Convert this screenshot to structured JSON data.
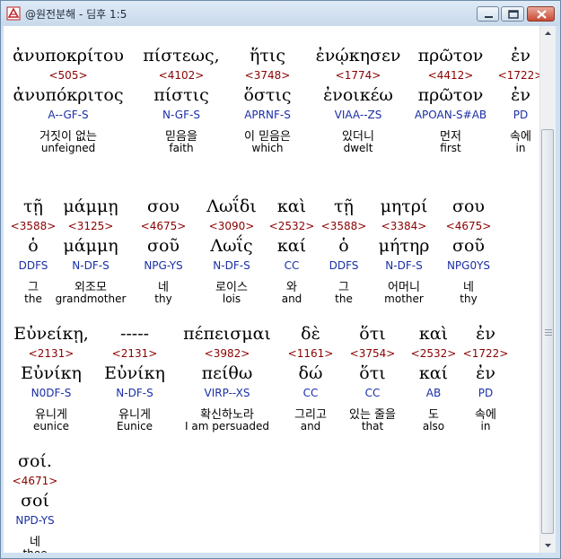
{
  "window": {
    "title": "@원전분해 - 딤후 1:5"
  },
  "verse_rows": [
    [
      {
        "greek": "ἀνυποκρίτου",
        "strong": "<505>",
        "lemma": "ἀνυπόκριτος",
        "parse": "A--GF-S",
        "korean": "거짓이 없는",
        "english": "unfeigned"
      },
      {
        "greek": "πίστεως,",
        "strong": "<4102>",
        "lemma": "πίστις",
        "parse": "N-GF-S",
        "korean": "믿음을",
        "english": "faith"
      },
      {
        "greek": "ἥτις",
        "strong": "<3748>",
        "lemma": "ὅστις",
        "parse": "APRNF-S",
        "korean": "이 믿음은",
        "english": "which"
      },
      {
        "greek": "ἐνῴκησεν",
        "strong": "<1774>",
        "lemma": "ἐνοικέω",
        "parse": "VIAA--ZS",
        "korean": "있더니",
        "english": "dwelt"
      },
      {
        "greek": "πρῶτον",
        "strong": "<4412>",
        "lemma": "πρῶτον",
        "parse": "APOAN-S#AB",
        "korean": "먼저",
        "english": "first"
      },
      {
        "greek": "ἐν",
        "strong": "<1722>",
        "lemma": "ἐν",
        "parse": "PD",
        "korean": "속에",
        "english": "in"
      }
    ],
    [
      {
        "greek": "τῇ",
        "strong": "<3588>",
        "lemma": "ὁ",
        "parse": "DDFS",
        "korean": "그",
        "english": "the"
      },
      {
        "greek": "μάμμῃ",
        "strong": "<3125>",
        "lemma": "μάμμη",
        "parse": "N-DF-S",
        "korean": "외조모",
        "english": "grandmother"
      },
      {
        "greek": "σου",
        "strong": "<4675>",
        "lemma": "σοῦ",
        "parse": "NPG-YS",
        "korean": "네",
        "english": "thy"
      },
      {
        "greek": "Λωΐδι",
        "strong": "<3090>",
        "lemma": "Λωΐς",
        "parse": "N-DF-S",
        "korean": "로이스",
        "english": "lois"
      },
      {
        "greek": "καὶ",
        "strong": "<2532>",
        "lemma": "καί",
        "parse": "CC",
        "korean": "와",
        "english": "and"
      },
      {
        "greek": "τῇ",
        "strong": "<3588>",
        "lemma": "ὁ",
        "parse": "DDFS",
        "korean": "그",
        "english": "the"
      },
      {
        "greek": "μητρί",
        "strong": "<3384>",
        "lemma": "μήτηρ",
        "parse": "N-DF-S",
        "korean": "어머니",
        "english": "mother"
      },
      {
        "greek": "σου",
        "strong": "<4675>",
        "lemma": "σοῦ",
        "parse": "NPG0YS",
        "korean": "네",
        "english": "thy"
      }
    ],
    [
      {
        "greek": "Εὐνείκῃ,",
        "strong": "<2131>",
        "lemma": "Εὐνίκη",
        "parse": "N0DF-S",
        "korean": "유니게",
        "english": "eunice"
      },
      {
        "greek": "-----",
        "strong": "<2131>",
        "lemma": "Εὐνίκη",
        "parse": "N-DF-S",
        "korean": "유니게",
        "english": "Eunice"
      },
      {
        "greek": "πέπεισμαι",
        "strong": "<3982>",
        "lemma": "πείθω",
        "parse": "VIRP--XS",
        "korean": "확신하노라",
        "english": "I am persuaded"
      },
      {
        "greek": "δὲ",
        "strong": "<1161>",
        "lemma": "δώ",
        "parse": "CC",
        "korean": "그리고",
        "english": "and"
      },
      {
        "greek": "ὅτι",
        "strong": "<3754>",
        "lemma": "ὅτι",
        "parse": "CC",
        "korean": "있는 줄을",
        "english": "that"
      },
      {
        "greek": "καὶ",
        "strong": "<2532>",
        "lemma": "καί",
        "parse": "AB",
        "korean": "도",
        "english": "also"
      },
      {
        "greek": "ἐν",
        "strong": "<1722>",
        "lemma": "ἐν",
        "parse": "PD",
        "korean": "속에",
        "english": "in"
      }
    ],
    [
      {
        "greek": "σοί.",
        "strong": "<4671>",
        "lemma": "σοί",
        "parse": "NPD-YS",
        "korean": "네",
        "english": "thee"
      }
    ]
  ],
  "colors": {
    "greek": "#000000",
    "strong": "#8b0000",
    "parse": "#1b2fa6",
    "client_bg": "#ffffff",
    "titlebar": "#c7d9ec"
  },
  "icons": [
    "app-icon",
    "minimize-icon",
    "maximize-icon",
    "close-icon",
    "scroll-up-arrow-icon",
    "scroll-down-arrow-icon",
    "scroll-grip-icon"
  ]
}
